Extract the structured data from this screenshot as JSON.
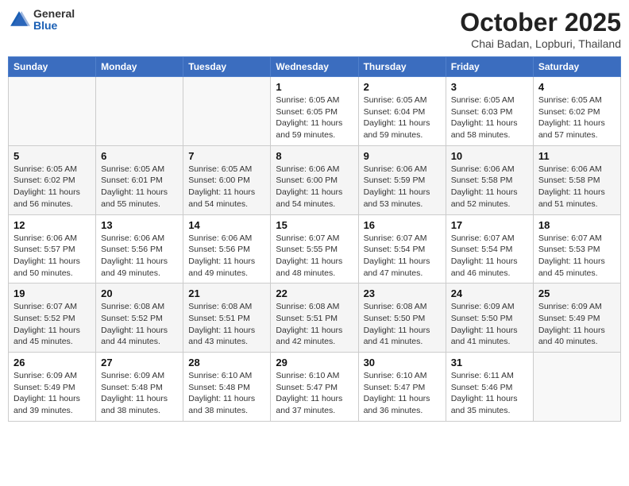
{
  "logo": {
    "general": "General",
    "blue": "Blue"
  },
  "title": "October 2025",
  "location": "Chai Badan, Lopburi, Thailand",
  "weekdays": [
    "Sunday",
    "Monday",
    "Tuesday",
    "Wednesday",
    "Thursday",
    "Friday",
    "Saturday"
  ],
  "weeks": [
    [
      {
        "day": "",
        "text": ""
      },
      {
        "day": "",
        "text": ""
      },
      {
        "day": "",
        "text": ""
      },
      {
        "day": "1",
        "text": "Sunrise: 6:05 AM\nSunset: 6:05 PM\nDaylight: 11 hours\nand 59 minutes."
      },
      {
        "day": "2",
        "text": "Sunrise: 6:05 AM\nSunset: 6:04 PM\nDaylight: 11 hours\nand 59 minutes."
      },
      {
        "day": "3",
        "text": "Sunrise: 6:05 AM\nSunset: 6:03 PM\nDaylight: 11 hours\nand 58 minutes."
      },
      {
        "day": "4",
        "text": "Sunrise: 6:05 AM\nSunset: 6:02 PM\nDaylight: 11 hours\nand 57 minutes."
      }
    ],
    [
      {
        "day": "5",
        "text": "Sunrise: 6:05 AM\nSunset: 6:02 PM\nDaylight: 11 hours\nand 56 minutes."
      },
      {
        "day": "6",
        "text": "Sunrise: 6:05 AM\nSunset: 6:01 PM\nDaylight: 11 hours\nand 55 minutes."
      },
      {
        "day": "7",
        "text": "Sunrise: 6:05 AM\nSunset: 6:00 PM\nDaylight: 11 hours\nand 54 minutes."
      },
      {
        "day": "8",
        "text": "Sunrise: 6:06 AM\nSunset: 6:00 PM\nDaylight: 11 hours\nand 54 minutes."
      },
      {
        "day": "9",
        "text": "Sunrise: 6:06 AM\nSunset: 5:59 PM\nDaylight: 11 hours\nand 53 minutes."
      },
      {
        "day": "10",
        "text": "Sunrise: 6:06 AM\nSunset: 5:58 PM\nDaylight: 11 hours\nand 52 minutes."
      },
      {
        "day": "11",
        "text": "Sunrise: 6:06 AM\nSunset: 5:58 PM\nDaylight: 11 hours\nand 51 minutes."
      }
    ],
    [
      {
        "day": "12",
        "text": "Sunrise: 6:06 AM\nSunset: 5:57 PM\nDaylight: 11 hours\nand 50 minutes."
      },
      {
        "day": "13",
        "text": "Sunrise: 6:06 AM\nSunset: 5:56 PM\nDaylight: 11 hours\nand 49 minutes."
      },
      {
        "day": "14",
        "text": "Sunrise: 6:06 AM\nSunset: 5:56 PM\nDaylight: 11 hours\nand 49 minutes."
      },
      {
        "day": "15",
        "text": "Sunrise: 6:07 AM\nSunset: 5:55 PM\nDaylight: 11 hours\nand 48 minutes."
      },
      {
        "day": "16",
        "text": "Sunrise: 6:07 AM\nSunset: 5:54 PM\nDaylight: 11 hours\nand 47 minutes."
      },
      {
        "day": "17",
        "text": "Sunrise: 6:07 AM\nSunset: 5:54 PM\nDaylight: 11 hours\nand 46 minutes."
      },
      {
        "day": "18",
        "text": "Sunrise: 6:07 AM\nSunset: 5:53 PM\nDaylight: 11 hours\nand 45 minutes."
      }
    ],
    [
      {
        "day": "19",
        "text": "Sunrise: 6:07 AM\nSunset: 5:52 PM\nDaylight: 11 hours\nand 45 minutes."
      },
      {
        "day": "20",
        "text": "Sunrise: 6:08 AM\nSunset: 5:52 PM\nDaylight: 11 hours\nand 44 minutes."
      },
      {
        "day": "21",
        "text": "Sunrise: 6:08 AM\nSunset: 5:51 PM\nDaylight: 11 hours\nand 43 minutes."
      },
      {
        "day": "22",
        "text": "Sunrise: 6:08 AM\nSunset: 5:51 PM\nDaylight: 11 hours\nand 42 minutes."
      },
      {
        "day": "23",
        "text": "Sunrise: 6:08 AM\nSunset: 5:50 PM\nDaylight: 11 hours\nand 41 minutes."
      },
      {
        "day": "24",
        "text": "Sunrise: 6:09 AM\nSunset: 5:50 PM\nDaylight: 11 hours\nand 41 minutes."
      },
      {
        "day": "25",
        "text": "Sunrise: 6:09 AM\nSunset: 5:49 PM\nDaylight: 11 hours\nand 40 minutes."
      }
    ],
    [
      {
        "day": "26",
        "text": "Sunrise: 6:09 AM\nSunset: 5:49 PM\nDaylight: 11 hours\nand 39 minutes."
      },
      {
        "day": "27",
        "text": "Sunrise: 6:09 AM\nSunset: 5:48 PM\nDaylight: 11 hours\nand 38 minutes."
      },
      {
        "day": "28",
        "text": "Sunrise: 6:10 AM\nSunset: 5:48 PM\nDaylight: 11 hours\nand 38 minutes."
      },
      {
        "day": "29",
        "text": "Sunrise: 6:10 AM\nSunset: 5:47 PM\nDaylight: 11 hours\nand 37 minutes."
      },
      {
        "day": "30",
        "text": "Sunrise: 6:10 AM\nSunset: 5:47 PM\nDaylight: 11 hours\nand 36 minutes."
      },
      {
        "day": "31",
        "text": "Sunrise: 6:11 AM\nSunset: 5:46 PM\nDaylight: 11 hours\nand 35 minutes."
      },
      {
        "day": "",
        "text": ""
      }
    ]
  ]
}
